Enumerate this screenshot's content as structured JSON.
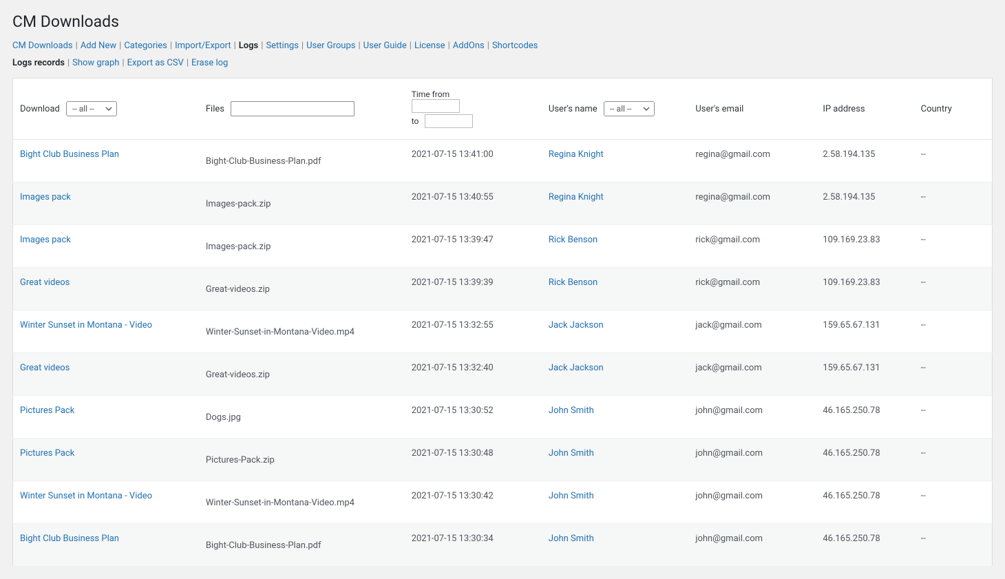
{
  "page": {
    "title": "CM Downloads"
  },
  "tabs": {
    "items": [
      {
        "label": "CM Downloads",
        "current": false
      },
      {
        "label": "Add New",
        "current": false
      },
      {
        "label": "Categories",
        "current": false
      },
      {
        "label": "Import/Export",
        "current": false
      },
      {
        "label": "Logs",
        "current": true
      },
      {
        "label": "Settings",
        "current": false
      },
      {
        "label": "User Groups",
        "current": false
      },
      {
        "label": "User Guide",
        "current": false
      },
      {
        "label": "License",
        "current": false
      },
      {
        "label": "AddOns",
        "current": false
      },
      {
        "label": "Shortcodes",
        "current": false
      }
    ]
  },
  "subtabs": {
    "items": [
      {
        "label": "Logs records",
        "current": true
      },
      {
        "label": "Show graph",
        "current": false
      },
      {
        "label": "Export as CSV",
        "current": false
      },
      {
        "label": "Erase log",
        "current": false
      }
    ]
  },
  "filters": {
    "download_label": "Download",
    "download_value": "-- all --",
    "files_label": "Files",
    "files_value": "",
    "time_from_label": "Time from",
    "time_to_label": "to",
    "time_from_value": "",
    "time_to_value": "",
    "user_label": "User's name",
    "user_value": "-- all --",
    "email_label": "User's email",
    "ip_label": "IP address",
    "country_label": "Country"
  },
  "rows": [
    {
      "download": "Bight Club Business Plan",
      "file": "Bight-Club-Business-Plan.pdf",
      "time": "2021-07-15 13:41:00",
      "user": "Regina Knight",
      "email": "regina@gmail.com",
      "ip": "2.58.194.135",
      "country": "--"
    },
    {
      "download": "Images pack",
      "file": "Images-pack.zip",
      "time": "2021-07-15 13:40:55",
      "user": "Regina Knight",
      "email": "regina@gmail.com",
      "ip": "2.58.194.135",
      "country": "--"
    },
    {
      "download": "Images pack",
      "file": "Images-pack.zip",
      "time": "2021-07-15 13:39:47",
      "user": "Rick Benson",
      "email": "rick@gmail.com",
      "ip": "109.169.23.83",
      "country": "--"
    },
    {
      "download": "Great videos",
      "file": "Great-videos.zip",
      "time": "2021-07-15 13:39:39",
      "user": "Rick Benson",
      "email": "rick@gmail.com",
      "ip": "109.169.23.83",
      "country": "--"
    },
    {
      "download": "Winter Sunset in Montana - Video",
      "file": "Winter-Sunset-in-Montana-Video.mp4",
      "time": "2021-07-15 13:32:55",
      "user": "Jack Jackson",
      "email": "jack@gmail.com",
      "ip": "159.65.67.131",
      "country": "--"
    },
    {
      "download": "Great videos",
      "file": "Great-videos.zip",
      "time": "2021-07-15 13:32:40",
      "user": "Jack Jackson",
      "email": "jack@gmail.com",
      "ip": "159.65.67.131",
      "country": "--"
    },
    {
      "download": "Pictures Pack",
      "file": "Dogs.jpg",
      "time": "2021-07-15 13:30:52",
      "user": "John Smith",
      "email": "john@gmail.com",
      "ip": "46.165.250.78",
      "country": "--"
    },
    {
      "download": "Pictures Pack",
      "file": "Pictures-Pack.zip",
      "time": "2021-07-15 13:30:48",
      "user": "John Smith",
      "email": "john@gmail.com",
      "ip": "46.165.250.78",
      "country": "--"
    },
    {
      "download": "Winter Sunset in Montana - Video",
      "file": "Winter-Sunset-in-Montana-Video.mp4",
      "time": "2021-07-15 13:30:42",
      "user": "John Smith",
      "email": "john@gmail.com",
      "ip": "46.165.250.78",
      "country": "--"
    },
    {
      "download": "Bight Club Business Plan",
      "file": "Bight-Club-Business-Plan.pdf",
      "time": "2021-07-15 13:30:34",
      "user": "John Smith",
      "email": "john@gmail.com",
      "ip": "46.165.250.78",
      "country": "--"
    }
  ]
}
